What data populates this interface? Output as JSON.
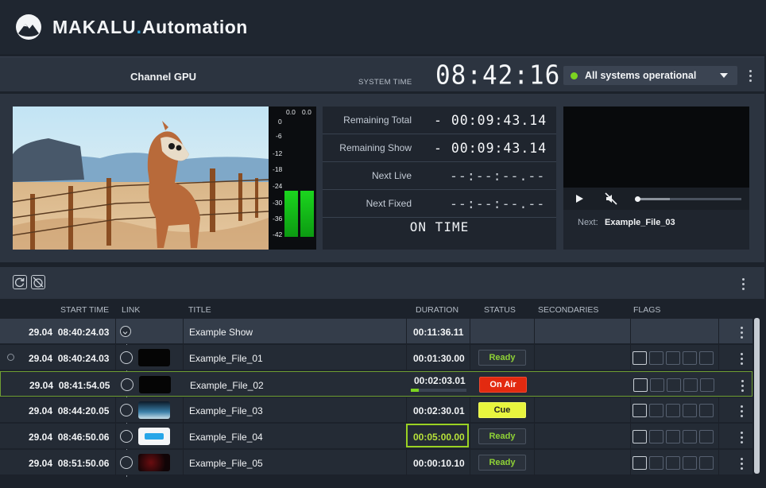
{
  "header": {
    "brand_main": "MAKALU",
    "brand_dot": ".",
    "brand_suffix": "Automation"
  },
  "statusbar": {
    "channel": "Channel GPU",
    "system_time_label": "SYSTEM TIME",
    "system_time": "08:42:16",
    "system_status": "All systems operational",
    "status_color": "#7cd420"
  },
  "meter": {
    "top_left": "0.0",
    "top_right": "0.0",
    "scale": [
      "0",
      "-6",
      "-12",
      "-18",
      "-24",
      "-30",
      "-36",
      "-42"
    ]
  },
  "timers": {
    "rows": [
      {
        "label": "Remaining Total",
        "value": "- 00:09:43.14"
      },
      {
        "label": "Remaining Show",
        "value": "- 00:09:43.14"
      },
      {
        "label": "Next Live",
        "value": "--:--:--.--"
      },
      {
        "label": "Next Fixed",
        "value": "--:--:--.--"
      }
    ],
    "state": "ON TIME"
  },
  "preview": {
    "next_label": "Next:",
    "next_value": "Example_File_03"
  },
  "columns": {
    "start": "START TIME",
    "link": "LINK",
    "title": "TITLE",
    "duration": "DURATION",
    "status": "STATUS",
    "secondaries": "SECONDARIES",
    "flags": "FLAGS"
  },
  "playlist": [
    {
      "date": "29.04",
      "time": "08:40:24.03",
      "title": "Example Show",
      "duration": "00:11:36.11",
      "status": ""
    },
    {
      "date": "29.04",
      "time": "08:40:24.03",
      "title": "Example_File_01",
      "duration": "00:01:30.00",
      "status": "Ready"
    },
    {
      "date": "29.04",
      "time": "08:41:54.05",
      "title": "Example_File_02",
      "duration": "00:02:03.01",
      "status": "On Air"
    },
    {
      "date": "29.04",
      "time": "08:44:20.05",
      "title": "Example_File_03",
      "duration": "00:02:30.01",
      "status": "Cue"
    },
    {
      "date": "29.04",
      "time": "08:46:50.06",
      "title": "Example_File_04",
      "duration": "00:05:00.00",
      "status": "Ready"
    },
    {
      "date": "29.04",
      "time": "08:51:50.06",
      "title": "Example_File_05",
      "duration": "00:00:10.10",
      "status": "Ready"
    }
  ],
  "colors": {
    "on_air": "#e32a10",
    "cue": "#e8f53e",
    "ready_text": "#8fd236",
    "accent": "#2aa9e0"
  }
}
